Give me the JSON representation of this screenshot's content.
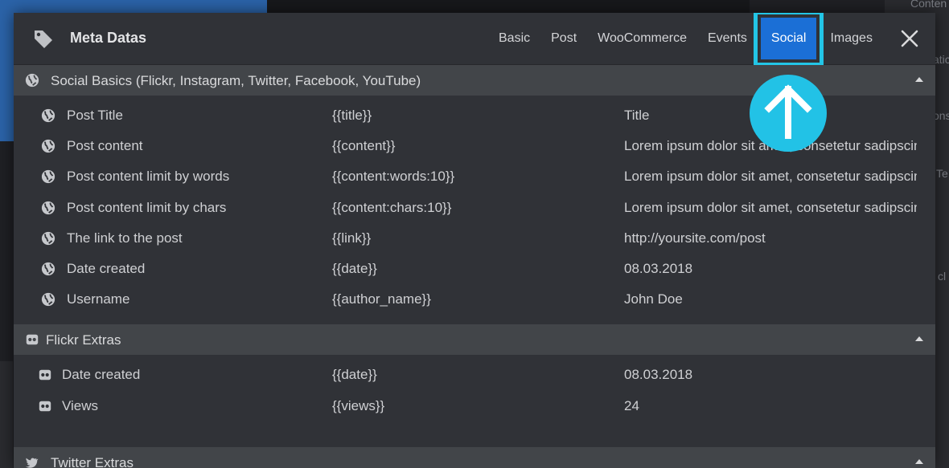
{
  "background": {
    "ghost_texts": [
      "Conten",
      "atic",
      "ons",
      "Te",
      "cl"
    ]
  },
  "modal": {
    "title": "Meta Datas",
    "tabs": [
      {
        "label": "Basic",
        "active": false
      },
      {
        "label": "Post",
        "active": false
      },
      {
        "label": "WooCommerce",
        "active": false
      },
      {
        "label": "Events",
        "active": false
      },
      {
        "label": "Social",
        "active": true
      },
      {
        "label": "Images",
        "active": false
      }
    ],
    "close_icon": "close-icon",
    "accent_color": "#1b6fd6",
    "highlight_color": "#23c5e6"
  },
  "sections": [
    {
      "title": "Social Basics (Flickr, Instagram, Twitter, Facebook, YouTube)",
      "icon": "globe-icon",
      "rows": [
        {
          "label": "Post Title",
          "tag": "{{title}}",
          "example": "Title"
        },
        {
          "label": "Post content",
          "tag": "{{content}}",
          "example": "Lorem ipsum dolor sit amet, consetetur sadipscing"
        },
        {
          "label": "Post content limit by words",
          "tag": "{{content:words:10}}",
          "example": "Lorem ipsum dolor sit amet, consetetur sadipscing"
        },
        {
          "label": "Post content limit by chars",
          "tag": "{{content:chars:10}}",
          "example": "Lorem ipsum dolor sit amet, consetetur sadipscing"
        },
        {
          "label": "The link to the post",
          "tag": "{{link}}",
          "example": "http://yoursite.com/post"
        },
        {
          "label": "Date created",
          "tag": "{{date}}",
          "example": "08.03.2018"
        },
        {
          "label": "Username",
          "tag": "{{author_name}}",
          "example": "John Doe"
        }
      ]
    },
    {
      "title": "Flickr Extras",
      "icon": "flickr-icon",
      "rows": [
        {
          "label": "Date created",
          "tag": "{{date}}",
          "example": "08.03.2018"
        },
        {
          "label": "Views",
          "tag": "{{views}}",
          "example": "24"
        }
      ]
    },
    {
      "title": "Twitter Extras",
      "icon": "twitter-icon",
      "rows": []
    }
  ]
}
